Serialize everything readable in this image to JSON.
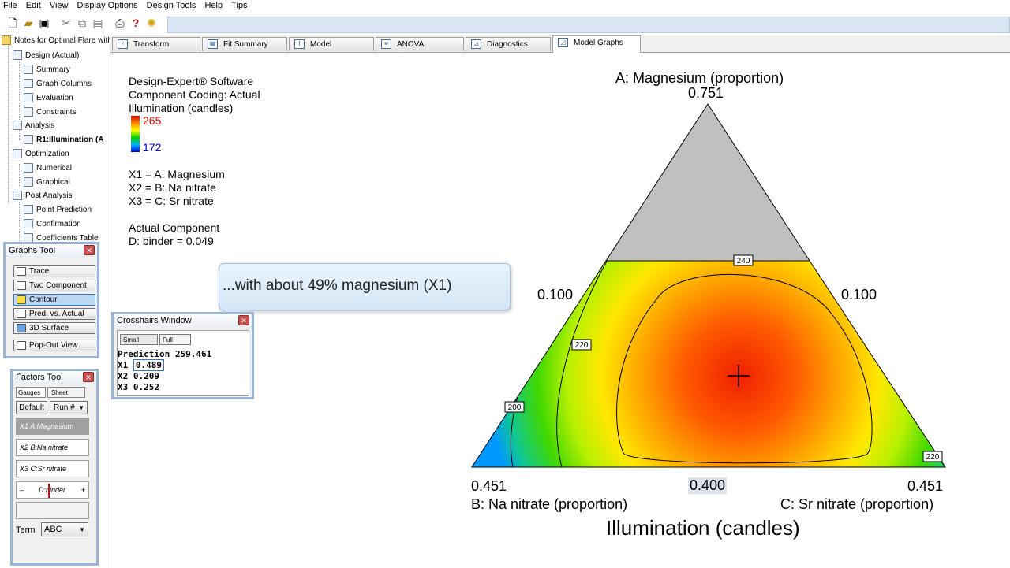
{
  "menu": [
    "File",
    "Edit",
    "View",
    "Display Options",
    "Design Tools",
    "Help",
    "Tips"
  ],
  "tree": {
    "root": "Notes for Optimal Flare with",
    "design": "Design (Actual)",
    "summary": "Summary",
    "graph_columns": "Graph Columns",
    "evaluation": "Evaluation",
    "constraints": "Constraints",
    "analysis": "Analysis",
    "r1": "R1:Illumination (A",
    "optimization": "Optimization",
    "numerical": "Numerical",
    "graphical": "Graphical",
    "post_analysis": "Post Analysis",
    "point_prediction": "Point Prediction",
    "confirmation": "Confirmation",
    "coefficients": "Coefficients Table"
  },
  "tabs": [
    "Transform",
    "Fit Summary",
    "Model",
    "ANOVA",
    "Diagnostics",
    "Model Graphs"
  ],
  "info": {
    "software": "Design-Expert® Software",
    "coding": "Component Coding: Actual",
    "response": "Illumination (candles)",
    "legend_high": "265",
    "legend_low": "172",
    "x1": "X1 = A: Magnesium",
    "x2": "X2 = B: Na nitrate",
    "x3": "X3 = C: Sr nitrate",
    "actual_component": "Actual Component",
    "binder": "D: binder = 0.049"
  },
  "callout": "...with about 49% magnesium (X1)",
  "graphs_tool": {
    "title": "Graphs Tool",
    "buttons": [
      "Trace",
      "Two Component",
      "Contour",
      "Pred. vs. Actual",
      "3D Surface"
    ],
    "popout": "Pop-Out View"
  },
  "crosshairs": {
    "title": "Crosshairs Window",
    "small": "Small",
    "full": "Full",
    "prediction": "Prediction 259.461",
    "x1_label": "X1",
    "x1_value": "0.489",
    "x2": "X2 0.209",
    "x3": "X3 0.252"
  },
  "factors_tool": {
    "title": "Factors Tool",
    "gauges": "Gauges",
    "sheet": "Sheet",
    "default": "Default",
    "run": "Run #",
    "f1": "X1  A:Magnesium",
    "f2": "X2  B:Na nitrate",
    "f3": "X3  C:Sr nitrate",
    "f4": "D:binder",
    "minus": "–",
    "plus": "+",
    "term_label": "Term",
    "term_value": "ABC"
  },
  "chart_data": {
    "type": "ternary contour",
    "title": "Illumination (candles)",
    "top_label": "A: Magnesium (proportion)",
    "left_label": "B: Na nitrate (proportion)",
    "right_label": "C: Sr nitrate (proportion)",
    "top_value": "0.751",
    "left_side_value": "0.100",
    "right_side_value": "0.100",
    "bottom_left_value": "0.451",
    "bottom_mid_value": "0.400",
    "bottom_right_value": "0.451",
    "contour_labels": [
      "240",
      "220",
      "200",
      "220"
    ],
    "crosshair": {
      "A": 0.489,
      "B": 0.209,
      "C": 0.252,
      "prediction": 259.461
    },
    "colors": {
      "high": "#e02000",
      "mid": "#ffe000",
      "low": "#30d000",
      "lowest": "#0090ff",
      "excluded": "#c0c0c0"
    }
  }
}
